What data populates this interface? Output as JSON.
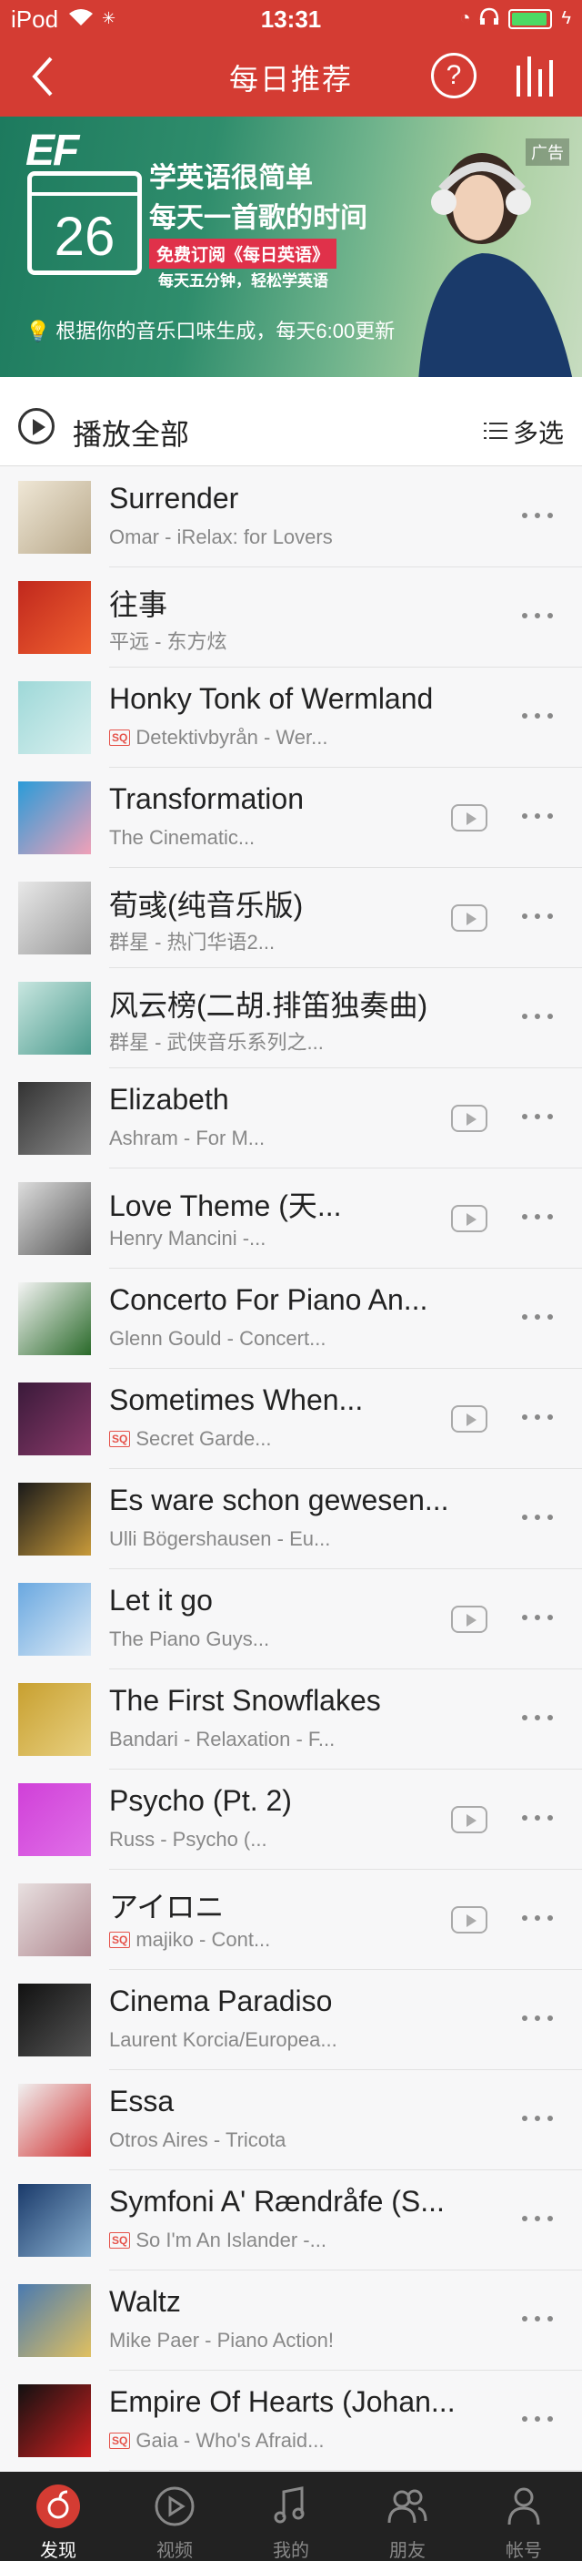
{
  "status": {
    "carrier": "iPod",
    "time": "13:31",
    "battery_level": 0.95
  },
  "nav": {
    "title": "每日推荐",
    "help_label": "?"
  },
  "banner": {
    "brand": "EF",
    "calendar_day": "26",
    "line1": "学英语很简单",
    "line2": "每天一首歌的时间",
    "subscribe": "免费订阅《每日英语》",
    "tagline": "每天五分钟，轻松学英语",
    "ad_badge": "广告",
    "caption": "根据你的音乐口味生成，每天6:00更新"
  },
  "play_all": {
    "label": "播放全部",
    "multi_select": "多选"
  },
  "songs": [
    {
      "title": "Surrender",
      "meta": "Omar - iRelax: for Lovers",
      "sq": false,
      "mv": false,
      "art": [
        "#efe7d6",
        "#b8a88a"
      ]
    },
    {
      "title": "往事",
      "meta": "平远 - 东方炫",
      "sq": false,
      "mv": false,
      "art": [
        "#c0281d",
        "#f06030"
      ]
    },
    {
      "title": "Honky Tonk of Wermland",
      "meta": "Detektivbyrån - Wer...",
      "sq": true,
      "mv": false,
      "art": [
        "#9ed8d8",
        "#d9f0ef"
      ]
    },
    {
      "title": "Transformation",
      "meta": "The Cinematic...",
      "sq": false,
      "mv": true,
      "art": [
        "#2a9bd8",
        "#f0a0b8"
      ]
    },
    {
      "title": "荀彧(纯音乐版)",
      "meta": "群星 - 热门华语2...",
      "sq": false,
      "mv": true,
      "art": [
        "#e8e8e8",
        "#999"
      ]
    },
    {
      "title": "风云榜(二胡.排笛独奏曲)",
      "meta": "群星 - 武侠音乐系列之...",
      "sq": false,
      "mv": false,
      "art": [
        "#c8e6e0",
        "#4a9a8c"
      ]
    },
    {
      "title": "Elizabeth",
      "meta": "Ashram - For M...",
      "sq": false,
      "mv": true,
      "art": [
        "#333",
        "#888"
      ]
    },
    {
      "title": "Love Theme (天...",
      "meta": "Henry Mancini -...",
      "sq": false,
      "mv": true,
      "art": [
        "#ddd",
        "#555"
      ]
    },
    {
      "title": "Concerto For Piano An...",
      "meta": "Glenn Gould - Concert...",
      "sq": false,
      "mv": false,
      "art": [
        "#f4f4f4",
        "#2a6a2a"
      ]
    },
    {
      "title": "Sometimes When...",
      "meta": "Secret Garde...",
      "sq": true,
      "mv": true,
      "art": [
        "#3a1a3a",
        "#8a3a6a"
      ]
    },
    {
      "title": "Es ware schon gewesen...",
      "meta": "Ulli Bögershausen - Eu...",
      "sq": false,
      "mv": false,
      "art": [
        "#1a1a1a",
        "#c89a3a"
      ]
    },
    {
      "title": "Let it go",
      "meta": "The Piano Guys...",
      "sq": false,
      "mv": true,
      "art": [
        "#6aa8e0",
        "#dceaf6"
      ]
    },
    {
      "title": "The First Snowflakes",
      "meta": "Bandari - Relaxation - F...",
      "sq": false,
      "mv": false,
      "art": [
        "#c8a030",
        "#e8d080"
      ]
    },
    {
      "title": "Psycho (Pt. 2)",
      "meta": "Russ - Psycho (...",
      "sq": false,
      "mv": true,
      "art": [
        "#d040d8",
        "#e070e8"
      ]
    },
    {
      "title": "アイロニ",
      "meta": "majiko - Cont...",
      "sq": true,
      "mv": true,
      "art": [
        "#e8e0e0",
        "#b08890"
      ]
    },
    {
      "title": "Cinema Paradiso",
      "meta": "Laurent Korcia/Europea...",
      "sq": false,
      "mv": false,
      "art": [
        "#111",
        "#555"
      ]
    },
    {
      "title": "Essa",
      "meta": "Otros Aires - Tricota",
      "sq": false,
      "mv": false,
      "art": [
        "#f0f0f0",
        "#d03030"
      ]
    },
    {
      "title": "Symfoni A' Rændråfe (S...",
      "meta": "So I'm An Islander -...",
      "sq": true,
      "mv": false,
      "art": [
        "#1a3a6a",
        "#8ab0d0"
      ]
    },
    {
      "title": "Waltz",
      "meta": "Mike Paer - Piano Action!",
      "sq": false,
      "mv": false,
      "art": [
        "#4a7ab0",
        "#e0c060"
      ]
    },
    {
      "title": "Empire Of Hearts (Johan...",
      "meta": "Gaia - Who's Afraid...",
      "sq": true,
      "mv": false,
      "art": [
        "#111",
        "#d02020"
      ]
    }
  ],
  "sq_badge": "SQ",
  "tabs": [
    {
      "label": "发现",
      "icon": "discover-icon",
      "active": true
    },
    {
      "label": "视频",
      "icon": "video-icon",
      "active": false
    },
    {
      "label": "我的",
      "icon": "music-note-icon",
      "active": false
    },
    {
      "label": "朋友",
      "icon": "friends-icon",
      "active": false
    },
    {
      "label": "帐号",
      "icon": "account-icon",
      "active": false
    }
  ],
  "colors": {
    "accent": "#d43c33",
    "tabbar": "#222222",
    "sq": "#e5534b"
  }
}
